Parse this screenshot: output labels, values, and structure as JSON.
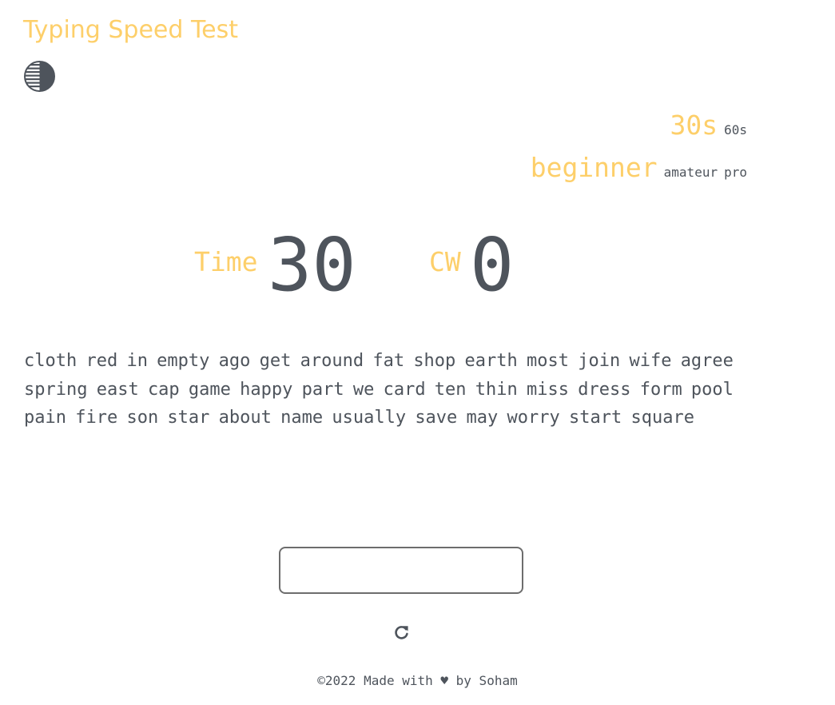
{
  "app": {
    "title": "Typing Speed Test"
  },
  "theme_toggle": {
    "icon": "half-circle-contrast-icon"
  },
  "time_options": {
    "selected": "30s",
    "other": "60s"
  },
  "level_options": {
    "selected": "beginner",
    "others": [
      "amateur",
      "pro"
    ]
  },
  "stats": {
    "time_label": "Time",
    "time_value": "30",
    "cw_label": "CW",
    "cw_value": "0"
  },
  "words": "cloth red in empty ago get around fat shop earth most join wife agree spring east cap game happy part we card ten thin miss dress form pool pain fire son star about name usually save may worry start square",
  "input": {
    "value": "",
    "placeholder": ""
  },
  "restart": {
    "icon": "restart-icon"
  },
  "footer": {
    "text": "©2022 Made with ♥ by Soham"
  },
  "colors": {
    "accent": "#fdcf6a",
    "text": "#4e545c",
    "background": "#ffffff"
  }
}
